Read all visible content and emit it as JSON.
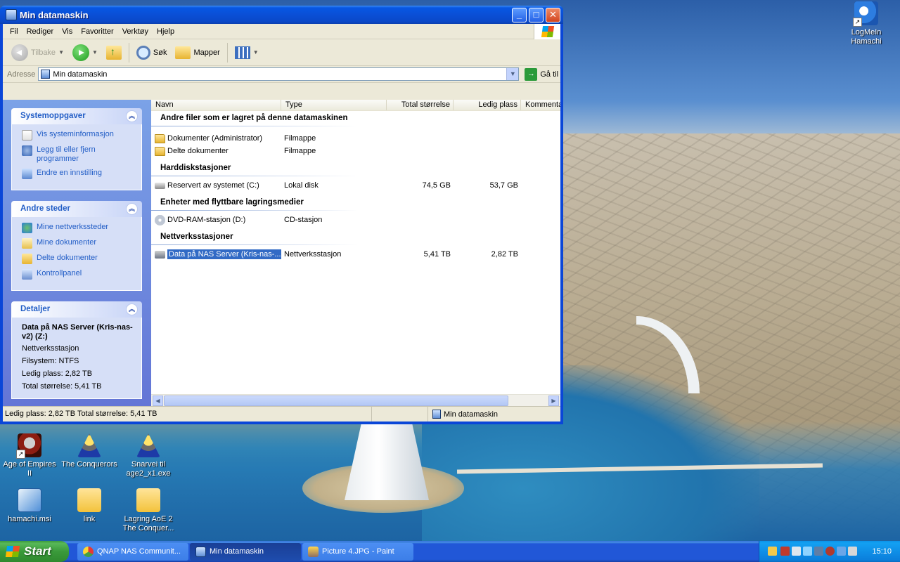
{
  "window": {
    "title": "Min datamaskin",
    "buttons": {
      "minimize": "_",
      "maximize": "□",
      "close": "✕"
    }
  },
  "menubar": [
    "Fil",
    "Rediger",
    "Vis",
    "Favoritter",
    "Verktøy",
    "Hjelp"
  ],
  "toolbar": {
    "back_label": "Tilbake",
    "search_label": "Søk",
    "folders_label": "Mapper"
  },
  "address": {
    "label": "Adresse",
    "value": "Min datamaskin",
    "go_label": "Gå til"
  },
  "taskpane": {
    "system": {
      "title": "Systemoppgaver",
      "links": [
        "Vis systeminformasjon",
        "Legg til eller fjern programmer",
        "Endre en innstilling"
      ]
    },
    "other": {
      "title": "Andre steder",
      "links": [
        "Mine nettverkssteder",
        "Mine dokumenter",
        "Delte dokumenter",
        "Kontrollpanel"
      ]
    },
    "details": {
      "title": "Detaljer",
      "name": "Data på NAS Server (Kris-nas-v2) (Z:)",
      "type": "Nettverksstasjon",
      "filesystem": "Filsystem: NTFS",
      "free": "Ledig plass: 2,82 TB",
      "total": "Total størrelse: 5,41 TB"
    }
  },
  "columns": [
    "Navn",
    "Type",
    "Total størrelse",
    "Ledig plass",
    "Kommentar"
  ],
  "groups": [
    {
      "title": "Andre filer som er lagret på denne datamaskinen",
      "items": [
        {
          "name": "Dokumenter (Administrator)",
          "type": "Filmappe",
          "total": "",
          "free": ""
        },
        {
          "name": "Delte dokumenter",
          "type": "Filmappe",
          "total": "",
          "free": ""
        }
      ]
    },
    {
      "title": "Harddiskstasjoner",
      "items": [
        {
          "name": "Reservert av systemet (C:)",
          "type": "Lokal disk",
          "total": "74,5 GB",
          "free": "53,7 GB"
        }
      ]
    },
    {
      "title": "Enheter med flyttbare lagringsmedier",
      "items": [
        {
          "name": "DVD-RAM-stasjon (D:)",
          "type": "CD-stasjon",
          "total": "",
          "free": ""
        }
      ]
    },
    {
      "title": "Nettverksstasjoner",
      "items": [
        {
          "name": "Data på NAS Server (Kris-nas-...",
          "type": "Nettverksstasjon",
          "total": "5,41 TB",
          "free": "2,82 TB"
        }
      ]
    }
  ],
  "statusbar": {
    "left": "Ledig plass: 2,82 TB Total størrelse: 5,41 TB",
    "right": "Min datamaskin"
  },
  "desktop_icons": [
    {
      "label": "Age of Empires II",
      "icon": "aoe-helmet-icon"
    },
    {
      "label": "The Conquerors",
      "icon": "knight-icon"
    },
    {
      "label": "Snarvei til age2_x1.exe",
      "icon": "knight-icon"
    },
    {
      "label": "hamachi.msi",
      "icon": "installer-icon"
    },
    {
      "label": "link",
      "icon": "folder-icon"
    },
    {
      "label": "Lagring AoE 2 The Conquer...",
      "icon": "folder-icon"
    },
    {
      "label": "LogMeIn Hamachi",
      "icon": "hamachi-icon"
    }
  ],
  "taskbar": {
    "start_label": "Start",
    "tasks": [
      {
        "label": "QNAP NAS Communit...",
        "icon": "chrome-icon",
        "active": false
      },
      {
        "label": "Min datamaskin",
        "icon": "my-computer-icon",
        "active": true
      },
      {
        "label": "Picture 4.JPG - Paint",
        "icon": "paint-icon",
        "active": false
      }
    ],
    "clock": "15:10"
  },
  "colors": {
    "selection": "#316ac5",
    "taskpane_link": "#215dc6",
    "title_blue": "#0a4fd6",
    "start_green": "#3a9a3a"
  }
}
